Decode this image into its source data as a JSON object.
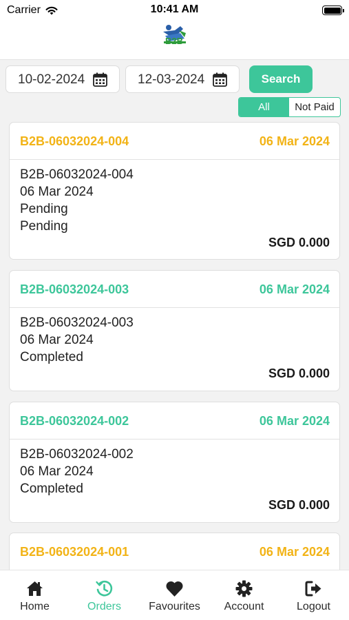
{
  "status_bar": {
    "carrier": "Carrier",
    "time": "10:41 AM"
  },
  "header": {
    "logo_text": "B2B"
  },
  "filters": {
    "from_date": "10-02-2024",
    "to_date": "12-03-2024",
    "search_label": "Search",
    "segment": {
      "all": "All",
      "not_paid": "Not Paid",
      "selected": "All"
    }
  },
  "orders": [
    {
      "id": "B2B-06032024-004",
      "date": "06 Mar 2024",
      "ref": "B2B-06032024-004",
      "order_date": "06 Mar 2024",
      "status": "Pending",
      "payment_status": "Pending",
      "amount": "SGD 0.000",
      "header_color": "#f2b316"
    },
    {
      "id": "B2B-06032024-003",
      "date": "06 Mar 2024",
      "ref": "B2B-06032024-003",
      "order_date": "06 Mar 2024",
      "status": "Completed",
      "amount": "SGD 0.000",
      "header_color": "#3dc69a"
    },
    {
      "id": "B2B-06032024-002",
      "date": "06 Mar 2024",
      "ref": "B2B-06032024-002",
      "order_date": "06 Mar 2024",
      "status": "Completed",
      "amount": "SGD 0.000",
      "header_color": "#3dc69a"
    },
    {
      "id": "B2B-06032024-001",
      "date": "06 Mar 2024",
      "header_color": "#f2b316"
    }
  ],
  "tabbar": {
    "active": "Orders",
    "accent_color": "#3dc69a",
    "tabs": [
      {
        "label": "Home",
        "icon": "home-icon"
      },
      {
        "label": "Orders",
        "icon": "orders-icon"
      },
      {
        "label": "Favourites",
        "icon": "heart-icon"
      },
      {
        "label": "Account",
        "icon": "gear-icon"
      },
      {
        "label": "Logout",
        "icon": "logout-icon"
      }
    ]
  }
}
